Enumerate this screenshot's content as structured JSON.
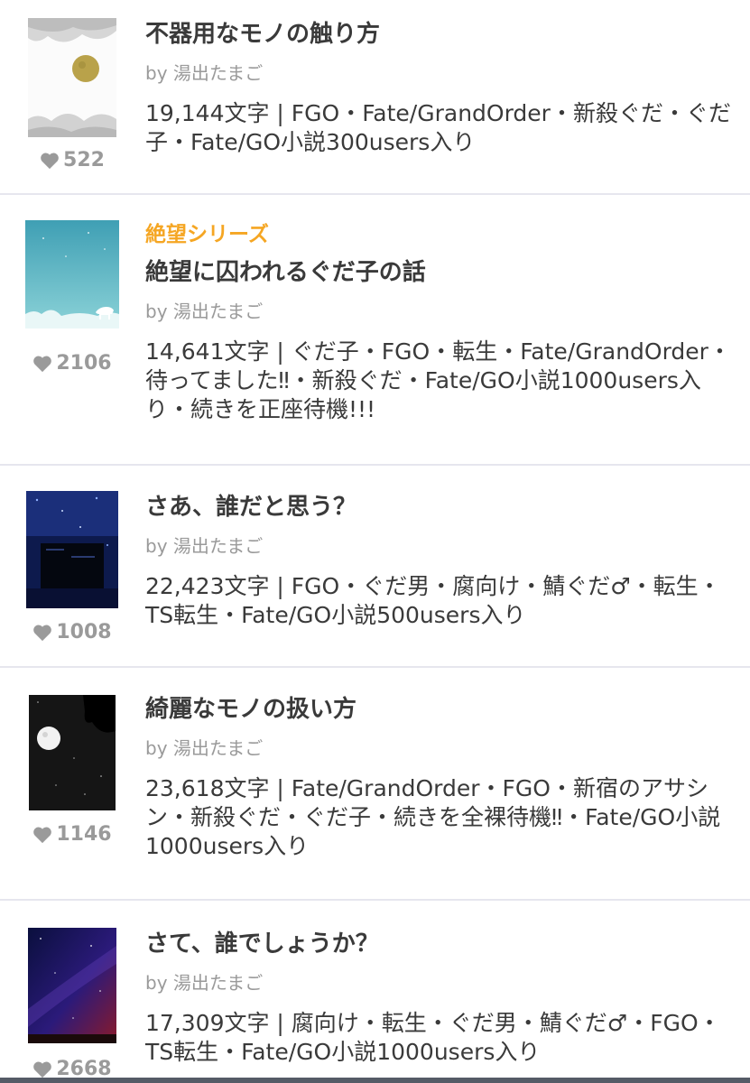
{
  "items": [
    {
      "series": "",
      "title": "不器用なモノの触り方",
      "author": "by 湯出たまご",
      "meta": "19,144文字 | FGO・Fate/GrandOrder・新殺ぐだ・ぐだ子・Fate/GO小説300users入り",
      "likes": "522"
    },
    {
      "series": "絶望シリーズ",
      "title": "絶望に囚われるぐだ子の話",
      "author": "by 湯出たまご",
      "meta": "14,641文字 | ぐだ子・FGO・転生・Fate/GrandOrder・待ってました‼・新殺ぐだ・Fate/GO小説1000users入り・続きを正座待機!!!",
      "likes": "2106"
    },
    {
      "series": "",
      "title": "さあ、誰だと思う？",
      "author": "by 湯出たまご",
      "meta": "22,423文字 | FGO・ぐだ男・腐向け・鯖ぐだ♂・転生・TS転生・Fate/GO小説500users入り",
      "likes": "1008"
    },
    {
      "series": "",
      "title": "綺麗なモノの扱い方",
      "author": "by 湯出たまご",
      "meta": "23,618文字 | Fate/GrandOrder・FGO・新宿のアサシン・新殺ぐだ・ぐだ子・続きを全裸待機‼・Fate/GO小説1000users入り",
      "likes": "1146"
    },
    {
      "series": "",
      "title": "さて、誰でしょうか？",
      "author": "by 湯出たまご",
      "meta": "17,309文字 | 腐向け・転生・ぐだ男・鯖ぐだ♂・FGO・TS転生・Fate/GO小説1000users入り",
      "likes": "2668"
    }
  ],
  "icons": {
    "heart": "heart-icon"
  },
  "colors": {
    "series": "#f5a623",
    "likes": "#9a9a9a",
    "divider": "#e6e6ee"
  }
}
